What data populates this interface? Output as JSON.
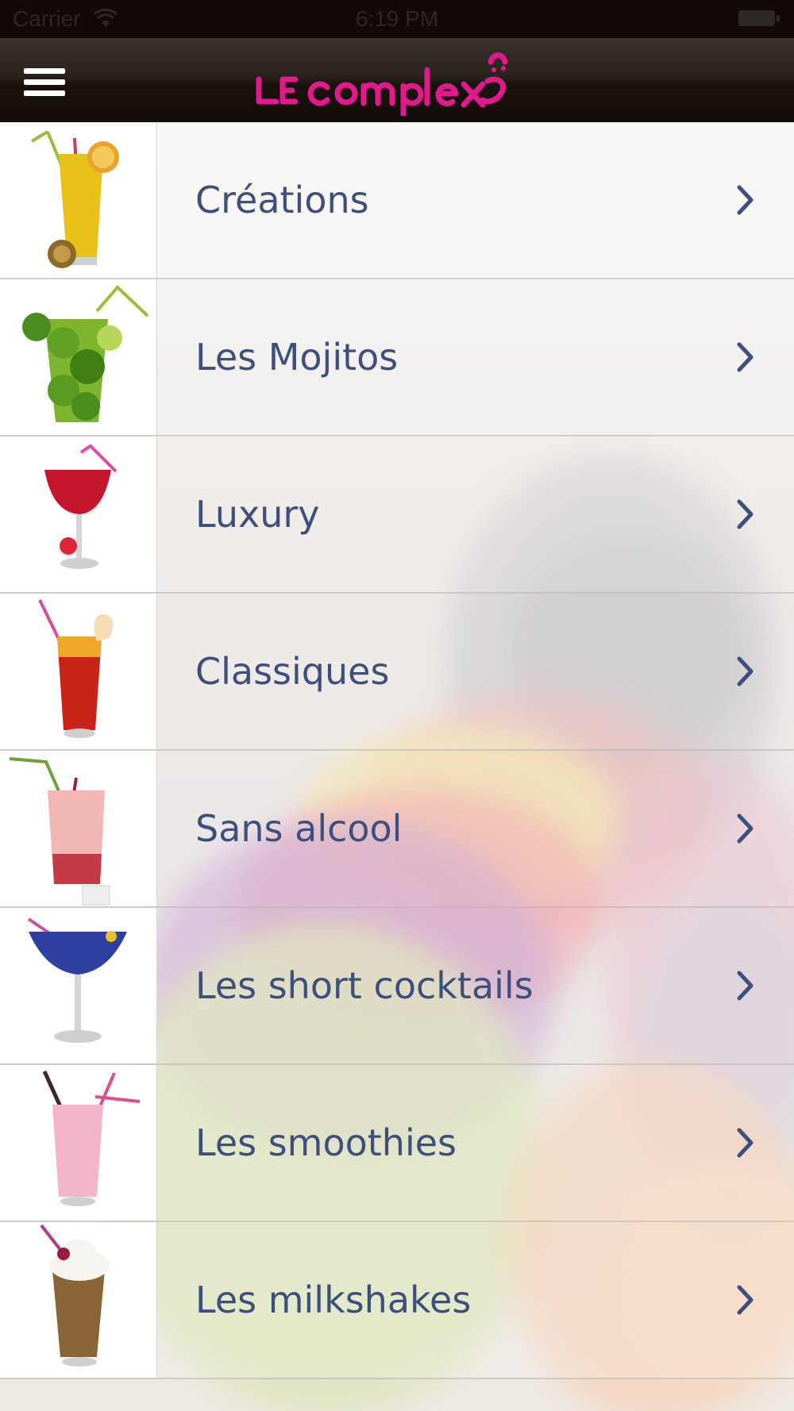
{
  "status_bar": {
    "carrier": "Carrier",
    "time": "6:19 PM"
  },
  "header": {
    "logo_text": "LE COMPLEX",
    "logo_color": "#e01a8c"
  },
  "menu": {
    "items": [
      {
        "label": "Créations"
      },
      {
        "label": "Les Mojitos"
      },
      {
        "label": "Luxury"
      },
      {
        "label": "Classiques"
      },
      {
        "label": "Sans alcool"
      },
      {
        "label": "Les short cocktails"
      },
      {
        "label": "Les smoothies"
      },
      {
        "label": "Les milkshakes"
      }
    ]
  },
  "colors": {
    "label": "#3d4f7d",
    "header_bg": "#1a120d",
    "accent": "#e01a8c"
  }
}
